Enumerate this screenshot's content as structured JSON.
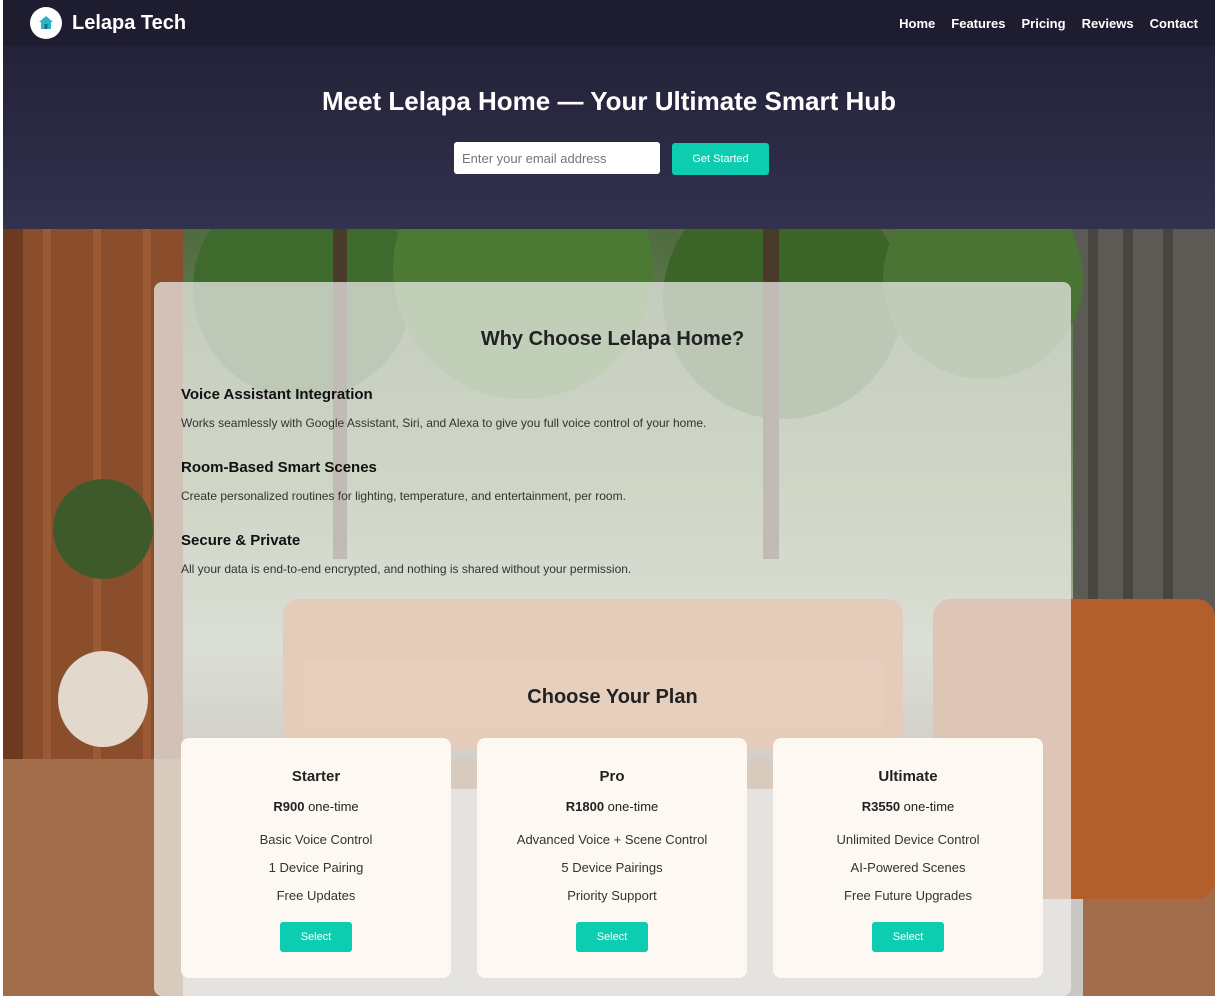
{
  "nav": {
    "brand": "Lelapa Tech",
    "links": [
      "Home",
      "Features",
      "Pricing",
      "Reviews",
      "Contact"
    ]
  },
  "hero": {
    "title": "Meet Lelapa Home — Your Ultimate Smart Hub",
    "email_placeholder": "Enter your email address",
    "cta_label": "Get Started"
  },
  "why": {
    "title": "Why Choose Lelapa Home?",
    "features": [
      {
        "title": "Voice Assistant Integration",
        "desc": "Works seamlessly with Google Assistant, Siri, and Alexa to give you full voice control of your home."
      },
      {
        "title": "Room-Based Smart Scenes",
        "desc": "Create personalized routines for lighting, temperature, and entertainment, per room."
      },
      {
        "title": "Secure & Private",
        "desc": "All your data is end-to-end encrypted, and nothing is shared without your permission."
      }
    ]
  },
  "pricing": {
    "title": "Choose Your Plan",
    "plans": [
      {
        "name": "Starter",
        "price": "R900",
        "term": "one-time",
        "features": [
          "Basic Voice Control",
          "1 Device Pairing",
          "Free Updates"
        ],
        "button": "Select"
      },
      {
        "name": "Pro",
        "price": "R1800",
        "term": "one-time",
        "features": [
          "Advanced Voice + Scene Control",
          "5 Device Pairings",
          "Priority Support"
        ],
        "button": "Select"
      },
      {
        "name": "Ultimate",
        "price": "R3550",
        "term": "one-time",
        "features": [
          "Unlimited Device Control",
          "AI-Powered Scenes",
          "Free Future Upgrades"
        ],
        "button": "Select"
      }
    ]
  },
  "colors": {
    "nav_bg": "#1e1d2f",
    "hero_bg": "#2c2b45",
    "accent": "#0dcdb0",
    "card_bg": "#fdf8f2"
  },
  "icons": [
    "home-logo-icon"
  ]
}
